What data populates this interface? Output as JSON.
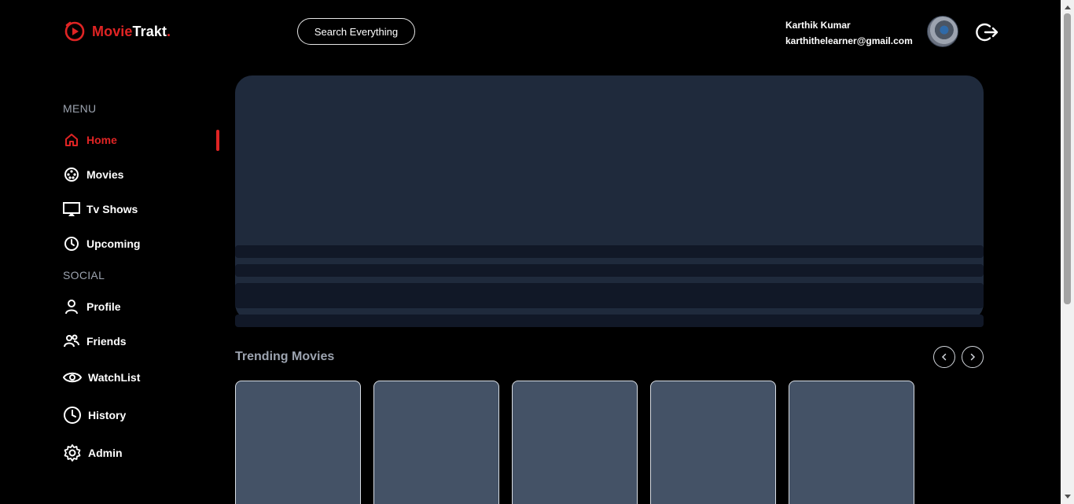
{
  "app": {
    "brand_part1": "Movie",
    "brand_part2": "Trakt",
    "brand_dot": ".",
    "accent_color": "#e02424"
  },
  "header": {
    "search_label": "Search Everything",
    "user_name": "Karthik Kumar",
    "user_email": "karthithelearner@gmail.com",
    "avatar_icon": "user-avatar",
    "logout_icon": "logout-icon"
  },
  "sidebar": {
    "menu_label": "MENU",
    "social_label": "SOCIAL",
    "menu_items": [
      {
        "label": "Home",
        "icon": "home-icon",
        "active": true
      },
      {
        "label": "Movies",
        "icon": "film-reel-icon",
        "active": false
      },
      {
        "label": "Tv Shows",
        "icon": "tv-icon",
        "active": false
      },
      {
        "label": "Upcoming",
        "icon": "clock-icon",
        "active": false
      }
    ],
    "social_items": [
      {
        "label": "Profile",
        "icon": "user-icon"
      },
      {
        "label": "Friends",
        "icon": "friends-icon"
      },
      {
        "label": "WatchList",
        "icon": "eye-icon"
      },
      {
        "label": "History",
        "icon": "history-icon"
      },
      {
        "label": "Admin",
        "icon": "gear-icon"
      }
    ]
  },
  "main": {
    "trending_title": "Trending Movies",
    "prev_icon": "chevron-left-icon",
    "next_icon": "chevron-right-icon",
    "card_count_visible": 5
  },
  "colors": {
    "background": "#000000",
    "hero_placeholder": "#1f2a3c",
    "card_placeholder": "#445266",
    "muted_text": "#9ca3af"
  }
}
